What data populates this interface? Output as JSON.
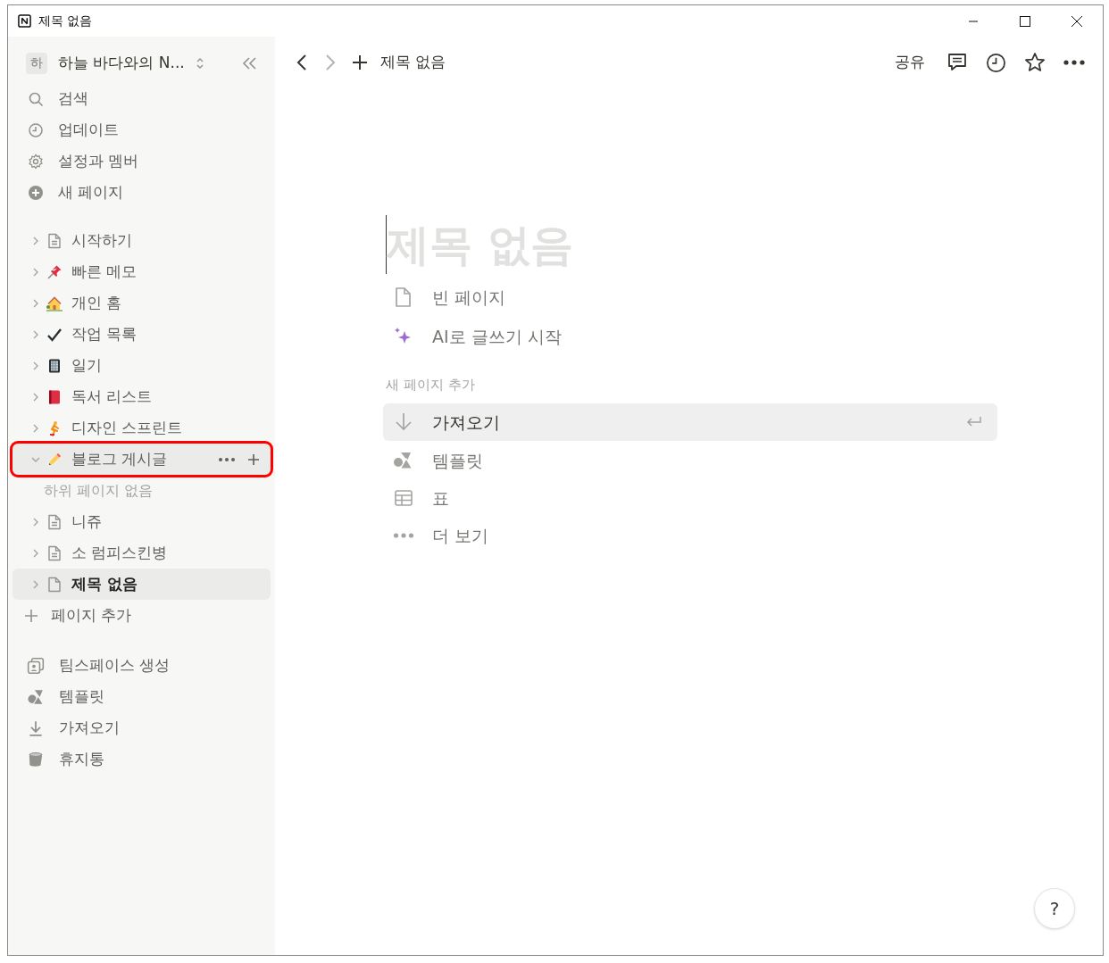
{
  "window": {
    "title": "제목 없음"
  },
  "sidebar": {
    "workspace": {
      "avatar": "하",
      "name": "하늘 바다와의 N..."
    },
    "menu": [
      {
        "kind": "search",
        "label": "검색"
      },
      {
        "kind": "updates",
        "label": "업데이트"
      },
      {
        "kind": "settings",
        "label": "설정과 멤버"
      },
      {
        "kind": "new",
        "label": "새 페이지"
      }
    ],
    "pages": [
      {
        "label": "시작하기",
        "kind": "page",
        "expanded": false,
        "selected": false,
        "highlighted": false
      },
      {
        "label": "빠른 메모",
        "kind": "pin",
        "expanded": false,
        "selected": false,
        "highlighted": false
      },
      {
        "label": "개인 홈",
        "kind": "house",
        "expanded": false,
        "selected": false,
        "highlighted": false
      },
      {
        "label": "작업 목록",
        "kind": "check",
        "expanded": false,
        "selected": false,
        "highlighted": false
      },
      {
        "label": "일기",
        "kind": "notebook",
        "expanded": false,
        "selected": false,
        "highlighted": false
      },
      {
        "label": "독서 리스트",
        "kind": "book",
        "expanded": false,
        "selected": false,
        "highlighted": false
      },
      {
        "label": "디자인 스프린트",
        "kind": "runner",
        "expanded": false,
        "selected": false,
        "highlighted": false
      },
      {
        "label": "블로그 게시글",
        "kind": "pencil",
        "expanded": true,
        "selected": false,
        "highlighted": true,
        "empty_note": "하위 페이지 없음"
      },
      {
        "label": "니쥬",
        "kind": "page",
        "expanded": false,
        "selected": false,
        "highlighted": false
      },
      {
        "label": "소 럼피스킨병",
        "kind": "page",
        "expanded": false,
        "selected": false,
        "highlighted": false
      },
      {
        "label": "제목 없음",
        "kind": "blank",
        "expanded": false,
        "selected": true,
        "highlighted": false
      }
    ],
    "add_page": "페이지 추가",
    "footer": [
      {
        "kind": "teamspace",
        "label": "팀스페이스 생성"
      },
      {
        "kind": "templates",
        "label": "템플릿"
      },
      {
        "kind": "import",
        "label": "가져오기"
      },
      {
        "kind": "trash",
        "label": "휴지통"
      }
    ]
  },
  "topbar": {
    "breadcrumb": "제목 없음",
    "share": "공유"
  },
  "editor": {
    "title_placeholder": "제목 없음",
    "options": [
      {
        "kind": "blank",
        "label": "빈 페이지"
      },
      {
        "kind": "ai",
        "label": "AI로 글쓰기 시작"
      }
    ],
    "section_label": "새 페이지 추가",
    "actions": [
      {
        "kind": "import",
        "label": "가져오기",
        "selected": true
      },
      {
        "kind": "templates",
        "label": "템플릿",
        "selected": false
      },
      {
        "kind": "table",
        "label": "표",
        "selected": false
      },
      {
        "kind": "more",
        "label": "더 보기",
        "selected": false
      }
    ]
  },
  "help": "?"
}
